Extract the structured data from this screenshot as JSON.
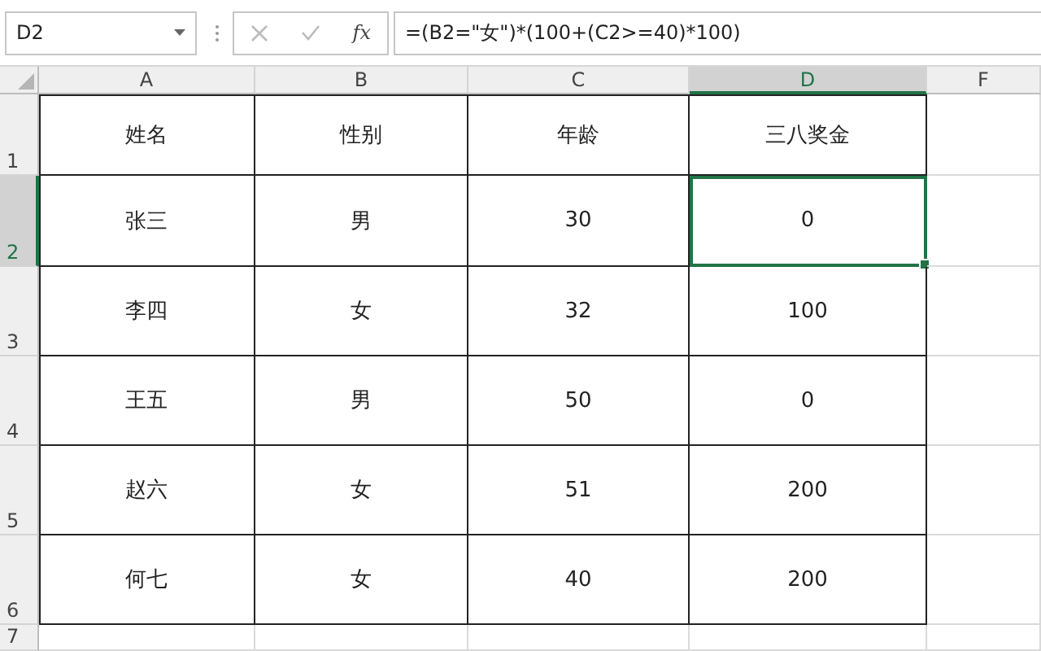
{
  "name_box": "D2",
  "function_button": "fx",
  "formula": "=(B2=\"女\")*(100+(C2>=40)*100)",
  "columns": [
    {
      "label": "A",
      "selected": false
    },
    {
      "label": "B",
      "selected": false
    },
    {
      "label": "C",
      "selected": false
    },
    {
      "label": "D",
      "selected": true
    },
    {
      "label": "F",
      "selected": false
    }
  ],
  "rows": [
    {
      "label": "1",
      "selected": false,
      "cells": [
        {
          "text": "姓名",
          "selected": false
        },
        {
          "text": "性别",
          "selected": false
        },
        {
          "text": "年龄",
          "selected": false
        },
        {
          "text": "三八奖金",
          "selected": false
        }
      ]
    },
    {
      "label": "2",
      "selected": true,
      "cells": [
        {
          "text": "张三",
          "selected": false
        },
        {
          "text": "男",
          "selected": false
        },
        {
          "text": "30",
          "selected": false
        },
        {
          "text": "0",
          "selected": true
        }
      ]
    },
    {
      "label": "3",
      "selected": false,
      "cells": [
        {
          "text": "李四",
          "selected": false
        },
        {
          "text": "女",
          "selected": false
        },
        {
          "text": "32",
          "selected": false
        },
        {
          "text": "100",
          "selected": false
        }
      ]
    },
    {
      "label": "4",
      "selected": false,
      "cells": [
        {
          "text": "王五",
          "selected": false
        },
        {
          "text": "男",
          "selected": false
        },
        {
          "text": "50",
          "selected": false
        },
        {
          "text": "0",
          "selected": false
        }
      ]
    },
    {
      "label": "5",
      "selected": false,
      "cells": [
        {
          "text": "赵六",
          "selected": false
        },
        {
          "text": "女",
          "selected": false
        },
        {
          "text": "51",
          "selected": false
        },
        {
          "text": "200",
          "selected": false
        }
      ]
    },
    {
      "label": "6",
      "selected": false,
      "cells": [
        {
          "text": "何七",
          "selected": false
        },
        {
          "text": "女",
          "selected": false
        },
        {
          "text": "40",
          "selected": false
        },
        {
          "text": "200",
          "selected": false
        }
      ]
    },
    {
      "label": "7",
      "selected": false,
      "cells": []
    }
  ]
}
